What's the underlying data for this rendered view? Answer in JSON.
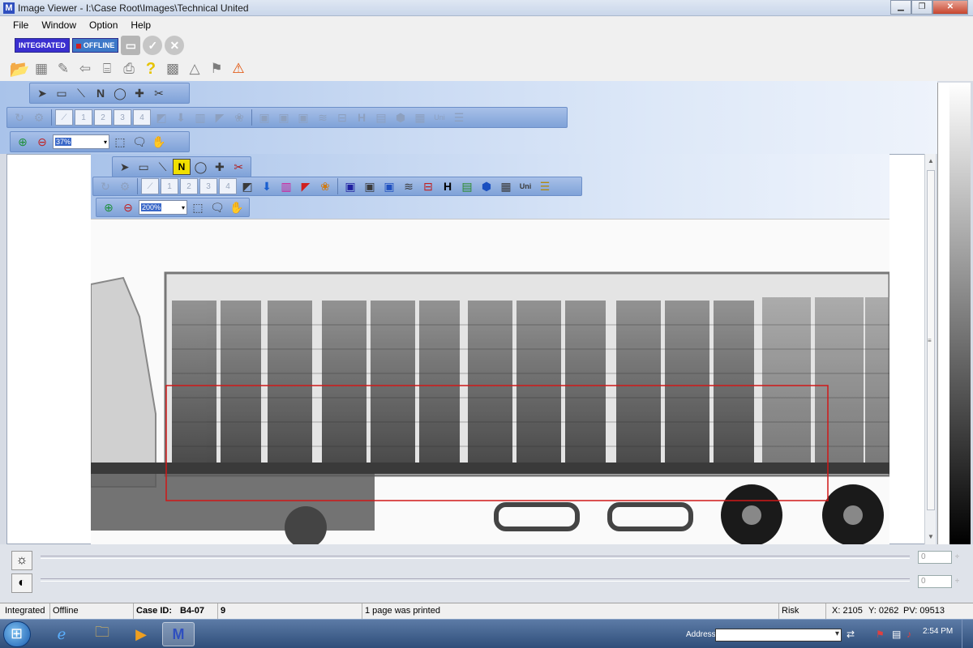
{
  "window": {
    "title": "Image Viewer - I:\\Case Root\\Images\\Technical United"
  },
  "menu": [
    "File",
    "Window",
    "Option",
    "Help"
  ],
  "toolbar_status": {
    "integrated": "INTEGRATED",
    "offline": "OFFLINE"
  },
  "outer_viewer": {
    "zoom": "37%"
  },
  "inner_viewer": {
    "zoom": "200%"
  },
  "mode_labels": {
    "normal": "N",
    "levels": [
      "1",
      "2",
      "3",
      "4"
    ],
    "h": "H",
    "uni": "Uni"
  },
  "sliders": {
    "brightness_value": "0",
    "contrast_value": "0"
  },
  "status": {
    "mode": "Integrated",
    "connection": "Offline",
    "case_id_label": "Case ID:",
    "case_id": "B4-07",
    "count": "9",
    "message": "1 page was printed",
    "risk": "Risk",
    "x": "X: 2105",
    "y": "Y: 0262",
    "pv": "PV: 09513"
  },
  "taskbar": {
    "address_label": "Address",
    "time": "2:54 PM"
  },
  "colors": {
    "toolbar_blue": "#7fa2d8",
    "roi_red": "#d01818"
  }
}
